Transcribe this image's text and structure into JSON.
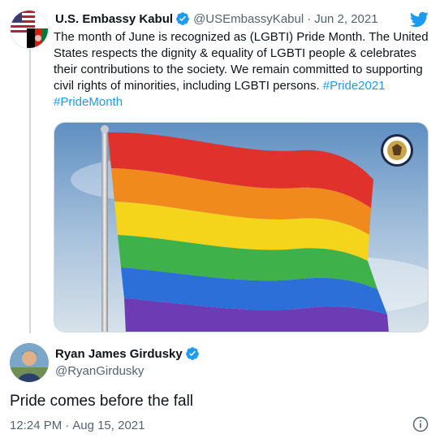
{
  "quoted_tweet": {
    "display_name": "U.S. Embassy Kabul",
    "handle": "@USEmbassyKabul",
    "separator": "·",
    "date": "Jun 2, 2021",
    "text": "The month of June is recognized as (LGBTI) Pride Month. The United States respects the dignity & equality of LGBTI people & celebrates their contributions to the society. We remain committed to supporting civil rights of minorities, including LGBTI persons. ",
    "hashtags": [
      "#Pride2021",
      "#PrideMonth"
    ],
    "media_icon": "rainbow-flag-image",
    "brand_icon": "twitter-bird-icon",
    "colors": {
      "link": "#1d9bf0",
      "verified": "#1d9bf0",
      "twitter": "#1d9bf0"
    }
  },
  "main_tweet": {
    "display_name": "Ryan James Girdusky",
    "handle": "@RyanGirdusky",
    "text": "Pride comes before the fall",
    "time": "12:24 PM",
    "separator": "·",
    "date": "Aug 15, 2021"
  }
}
